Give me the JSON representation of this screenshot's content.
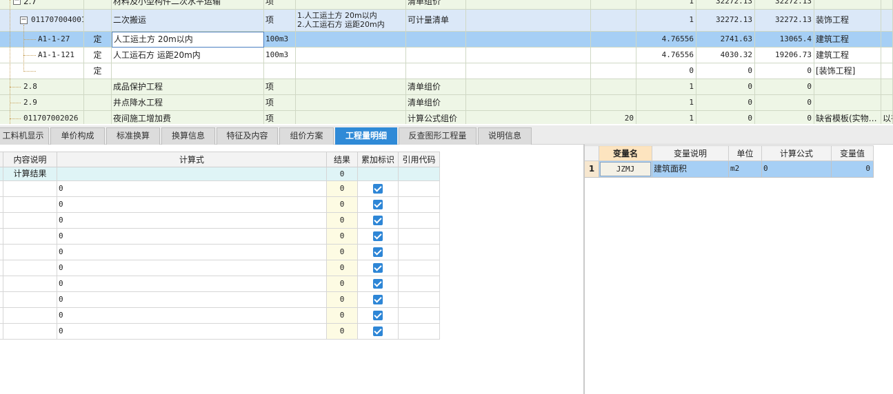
{
  "top_table": {
    "rows": [
      {
        "code": "2.7",
        "type": "",
        "name": "材料及小型构件二次水平运输",
        "unit": "项",
        "feature": "",
        "calc_method": "清单组价",
        "c6": "",
        "c7": "",
        "qty": "1",
        "price": "32272.13",
        "total": "32272.13",
        "specialty": "",
        "extra": ""
      },
      {
        "code": "011707004001",
        "type": "",
        "name": "二次搬运",
        "unit": "项",
        "feature": "1.人工运土方 20m以内\n2.人工运石方 运距20m内",
        "calc_method": "可计量清单",
        "c6": "",
        "c7": "",
        "qty": "1",
        "price": "32272.13",
        "total": "32272.13",
        "specialty": "装饰工程",
        "extra": ""
      },
      {
        "code": "A1-1-27",
        "type": "定",
        "name": "人工运土方 20m以内",
        "unit": "100m3",
        "feature": "",
        "calc_method": "",
        "c6": "",
        "c7": "",
        "qty": "4.76556",
        "price": "2741.63",
        "total": "13065.4",
        "specialty": "建筑工程",
        "extra": ""
      },
      {
        "code": "A1-1-121",
        "type": "定",
        "name": "人工运石方 运距20m内",
        "unit": "100m3",
        "feature": "",
        "calc_method": "",
        "c6": "",
        "c7": "",
        "qty": "4.76556",
        "price": "4030.32",
        "total": "19206.73",
        "specialty": "建筑工程",
        "extra": ""
      },
      {
        "code": "",
        "type": "定",
        "name": "",
        "unit": "",
        "feature": "",
        "calc_method": "",
        "c6": "",
        "c7": "",
        "qty": "0",
        "price": "0",
        "total": "0",
        "specialty": "[装饰工程]",
        "extra": ""
      },
      {
        "code": "2.8",
        "type": "",
        "name": "成品保护工程",
        "unit": "项",
        "feature": "",
        "calc_method": "清单组价",
        "c6": "",
        "c7": "",
        "qty": "1",
        "price": "0",
        "total": "0",
        "specialty": "",
        "extra": ""
      },
      {
        "code": "2.9",
        "type": "",
        "name": "井点降水工程",
        "unit": "项",
        "feature": "",
        "calc_method": "清单组价",
        "c6": "",
        "c7": "",
        "qty": "1",
        "price": "0",
        "total": "0",
        "specialty": "",
        "extra": ""
      },
      {
        "code": "011707002026",
        "type": "",
        "name": "夜间施工增加费",
        "unit": "项",
        "feature": "",
        "calc_method": "计算公式组价",
        "c6": "",
        "c7": "20",
        "qty": "1",
        "price": "0",
        "total": "0",
        "specialty": "缺省模板(实物…",
        "extra": "以有"
      }
    ]
  },
  "tabs": [
    "工料机显示",
    "单价构成",
    "标准换算",
    "换算信息",
    "特征及内容",
    "组价方案",
    "工程量明细",
    "反查图形工程量",
    "说明信息"
  ],
  "active_tab": "工程量明细",
  "calc_table": {
    "headers": [
      "内容说明",
      "计算式",
      "结果",
      "累加标识",
      "引用代码"
    ],
    "summary_row": {
      "desc": "计算结果",
      "formula": "",
      "result": "0"
    },
    "rows": [
      {
        "formula": "0",
        "result": "0"
      },
      {
        "formula": "0",
        "result": "0"
      },
      {
        "formula": "0",
        "result": "0"
      },
      {
        "formula": "0",
        "result": "0"
      },
      {
        "formula": "0",
        "result": "0"
      },
      {
        "formula": "0",
        "result": "0"
      },
      {
        "formula": "0",
        "result": "0"
      },
      {
        "formula": "0",
        "result": "0"
      },
      {
        "formula": "0",
        "result": "0"
      },
      {
        "formula": "0",
        "result": "0"
      }
    ]
  },
  "var_table": {
    "headers": [
      "变量名",
      "变量说明",
      "单位",
      "计算公式",
      "变量值"
    ],
    "rows": [
      {
        "index": "1",
        "name": "JZMJ",
        "desc": "建筑面积",
        "unit": "m2",
        "formula": "0",
        "value": "0"
      }
    ]
  },
  "colors": {
    "active_tab": "#2f8ad7",
    "selected_row": "#a6cff5",
    "checkbox": "#2e86d6"
  }
}
